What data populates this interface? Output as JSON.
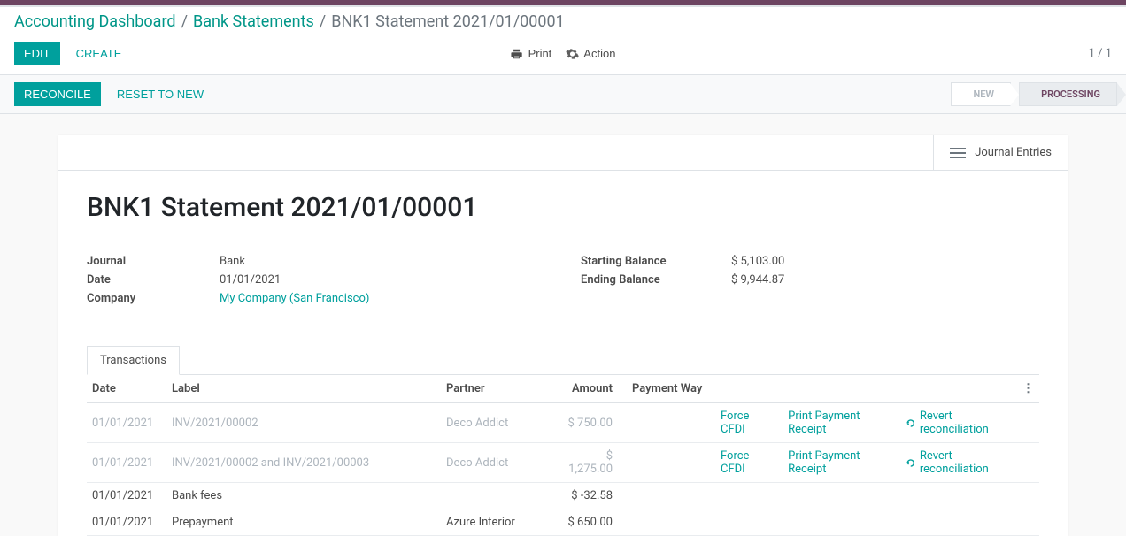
{
  "breadcrumb": {
    "root": "Accounting Dashboard",
    "mid": "Bank Statements",
    "current": "BNK1 Statement 2021/01/00001"
  },
  "controls": {
    "edit": "EDIT",
    "create": "CREATE",
    "print": "Print",
    "action": "Action",
    "pager": "1 / 1"
  },
  "status": {
    "reconcile": "RECONCILE",
    "reset": "RESET TO NEW",
    "new": "NEW",
    "processing": "PROCESSING"
  },
  "sheet": {
    "journal_entries": "Journal Entries",
    "title": "BNK1 Statement 2021/01/00001",
    "left_fields": {
      "journal_label": "Journal",
      "journal_value": "Bank",
      "date_label": "Date",
      "date_value": "01/01/2021",
      "company_label": "Company",
      "company_value": "My Company (San Francisco)"
    },
    "right_fields": {
      "start_label": "Starting Balance",
      "start_value": "$ 5,103.00",
      "end_label": "Ending Balance",
      "end_value": "$ 9,944.87"
    }
  },
  "tabs": {
    "transactions": "Transactions"
  },
  "table": {
    "headers": {
      "date": "Date",
      "label": "Label",
      "partner": "Partner",
      "amount": "Amount",
      "payment_way": "Payment Way"
    },
    "actions": {
      "force": "Force CFDI",
      "print_receipt": "Print Payment Receipt",
      "revert": "Revert reconciliation"
    },
    "rows": [
      {
        "date": "01/01/2021",
        "label": "INV/2021/00002",
        "partner": "Deco Addict",
        "amount": "$ 750.00",
        "muted": true,
        "actions": true
      },
      {
        "date": "01/01/2021",
        "label": "INV/2021/00002 and INV/2021/00003",
        "partner": "Deco Addict",
        "amount": "$ 1,275.00",
        "muted": true,
        "actions": true
      },
      {
        "date": "01/01/2021",
        "label": "Bank fees",
        "partner": "",
        "amount": "$ -32.58",
        "muted": false,
        "actions": false
      },
      {
        "date": "01/01/2021",
        "label": "Prepayment",
        "partner": "Azure Interior",
        "amount": "$ 650.00",
        "muted": false,
        "actions": false
      }
    ]
  }
}
